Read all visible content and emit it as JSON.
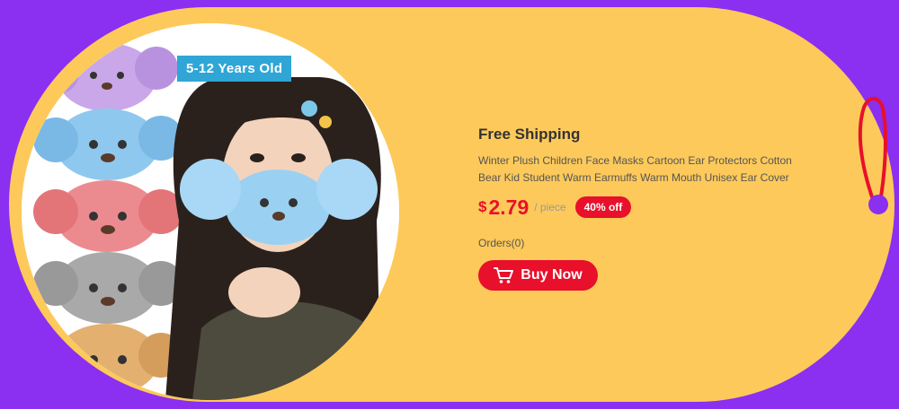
{
  "product": {
    "age_badge": "5-12 Years Old",
    "title": "Free Shipping",
    "description": "Winter Plush Children Face Masks Cartoon Ear Protectors Cotton Bear Kid Student Warm Earmuffs Warm Mouth Unisex Ear Cover",
    "currency": "$",
    "price": "2.79",
    "unit": "/ piece",
    "discount": "40% off",
    "orders": "Orders(0)",
    "buy_label": "Buy Now"
  },
  "colors": {
    "background_purple": "#8b2ff0",
    "tag_yellow": "#fdc95a",
    "accent_red": "#e8102b",
    "badge_blue": "#2fa6d6"
  },
  "icons": {
    "cart": "cart-icon",
    "hang_string": "hang-string-icon"
  }
}
